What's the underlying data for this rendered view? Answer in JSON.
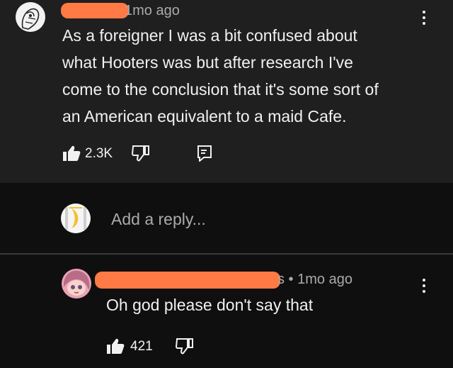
{
  "comment": {
    "timestamp": "1mo ago",
    "lines": [
      "As a foreigner I was a bit confused about",
      "what  Hooters was but after research I've",
      "come to the conclusion that it's some sort of",
      "an  American equivalent to a maid Cafe."
    ],
    "like_count": "2.3K"
  },
  "reply_box": {
    "placeholder": "Add a reply..."
  },
  "reply": {
    "timestamp": "s • 1mo ago",
    "text": "Oh god please don't say that",
    "like_count": "421"
  },
  "colors": {
    "background": "#0f0f0f",
    "panel": "#1f1f1f",
    "redaction": "#ff7a45",
    "secondary_text": "#aaaaaa"
  },
  "icons": [
    "avatar",
    "kebab-menu-icon",
    "thumbs-up-icon",
    "thumbs-down-icon",
    "reply-icon"
  ]
}
